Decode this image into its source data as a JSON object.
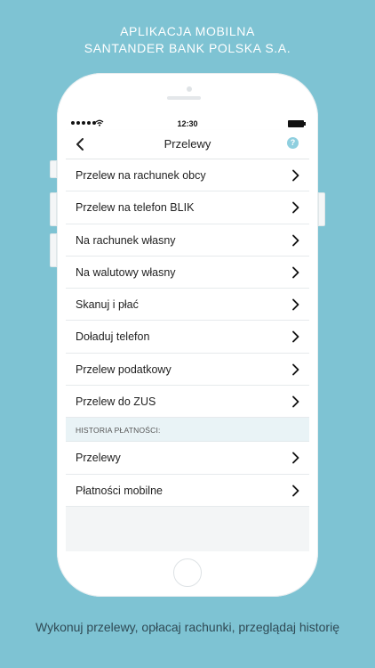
{
  "promo": {
    "title_line1": "APLIKACJA MOBILNA",
    "title_line2": "SANTANDER BANK POLSKA S.A.",
    "caption": "Wykonuj przelewy, opłacaj rachunki, przeglądaj historię"
  },
  "statusbar": {
    "time": "12:30"
  },
  "navbar": {
    "title": "Przelewy",
    "help": "?"
  },
  "menu": {
    "items": [
      {
        "label": "Przelew na rachunek obcy"
      },
      {
        "label": "Przelew na telefon BLIK"
      },
      {
        "label": "Na rachunek własny"
      },
      {
        "label": "Na walutowy własny"
      },
      {
        "label": "Skanuj i płać"
      },
      {
        "label": "Doładuj telefon"
      },
      {
        "label": "Przelew podatkowy"
      },
      {
        "label": "Przelew do ZUS"
      }
    ]
  },
  "history": {
    "header": "HISTORIA PŁATNOŚCI:",
    "items": [
      {
        "label": "Przelewy"
      },
      {
        "label": "Płatności mobilne"
      }
    ]
  },
  "colors": {
    "background": "#7ec3d3",
    "help_badge": "#8fcfdf",
    "section_bg": "#e9f3f6"
  }
}
